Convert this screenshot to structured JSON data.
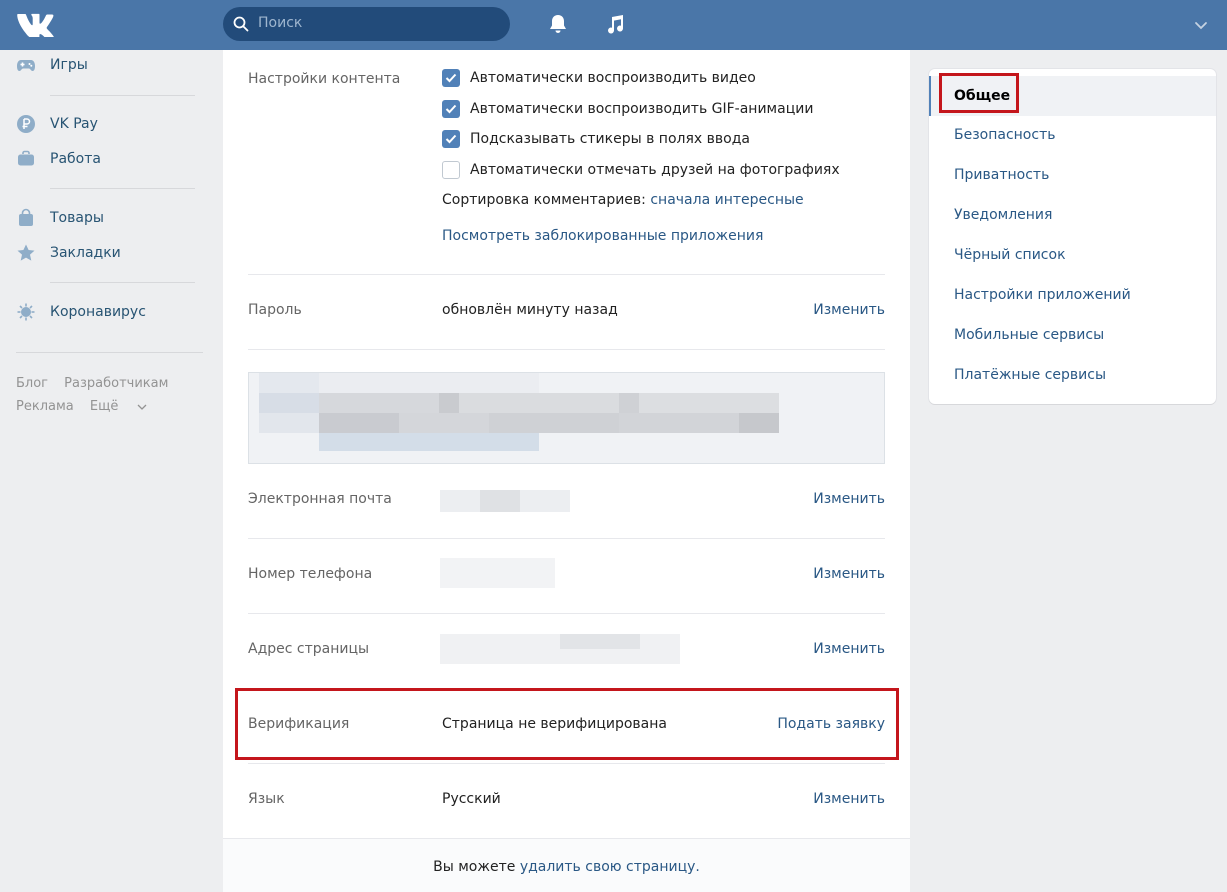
{
  "header": {
    "search_placeholder": "Поиск"
  },
  "leftnav": {
    "items": [
      {
        "label": "Игры",
        "icon": "gamepad-icon"
      },
      {
        "label": "VK Pay",
        "icon": "ruble-icon"
      },
      {
        "label": "Работа",
        "icon": "briefcase-icon"
      },
      {
        "label": "Товары",
        "icon": "shopping-bag-icon"
      },
      {
        "label": "Закладки",
        "icon": "star-icon"
      },
      {
        "label": "Коронавирус",
        "icon": "virus-icon"
      }
    ],
    "footer": {
      "blog": "Блог",
      "developers": "Разработчикам",
      "ads": "Реклама",
      "more": "Ещё"
    }
  },
  "main": {
    "content_settings": {
      "label": "Настройки контента",
      "checkboxes": [
        {
          "label": "Автоматически воспроизводить видео",
          "checked": true
        },
        {
          "label": "Автоматически воспроизводить GIF-анимации",
          "checked": true
        },
        {
          "label": "Подсказывать стикеры в полях ввода",
          "checked": true
        },
        {
          "label": "Автоматически отмечать друзей на фотографиях",
          "checked": false
        }
      ],
      "sort_label": "Сортировка комментариев:",
      "sort_value": "сначала интересные",
      "blocked_apps_link": "Посмотреть заблокированные приложения"
    },
    "password": {
      "label": "Пароль",
      "value": "обновлён минуту назад",
      "action": "Изменить"
    },
    "email": {
      "label": "Электронная почта",
      "action": "Изменить"
    },
    "phone": {
      "label": "Номер телефона",
      "action": "Изменить"
    },
    "address": {
      "label": "Адрес страницы",
      "action": "Изменить"
    },
    "verification": {
      "label": "Верификация",
      "value": "Страница не верифицирована",
      "action": "Подать заявку"
    },
    "language": {
      "label": "Язык",
      "value": "Русский",
      "action": "Изменить"
    },
    "delete": {
      "prefix": "Вы можете",
      "link": "удалить свою страницу",
      "suffix": "."
    }
  },
  "rightmenu": {
    "active": "Общее",
    "items": [
      "Безопасность",
      "Приватность",
      "Уведомления",
      "Чёрный список",
      "Настройки приложений",
      "Мобильные сервисы",
      "Платёжные сервисы"
    ]
  },
  "colors": {
    "header": "#4a76a8",
    "link": "#2a5885",
    "highlight": "#c4161c",
    "checkbox": "#5181b8"
  }
}
